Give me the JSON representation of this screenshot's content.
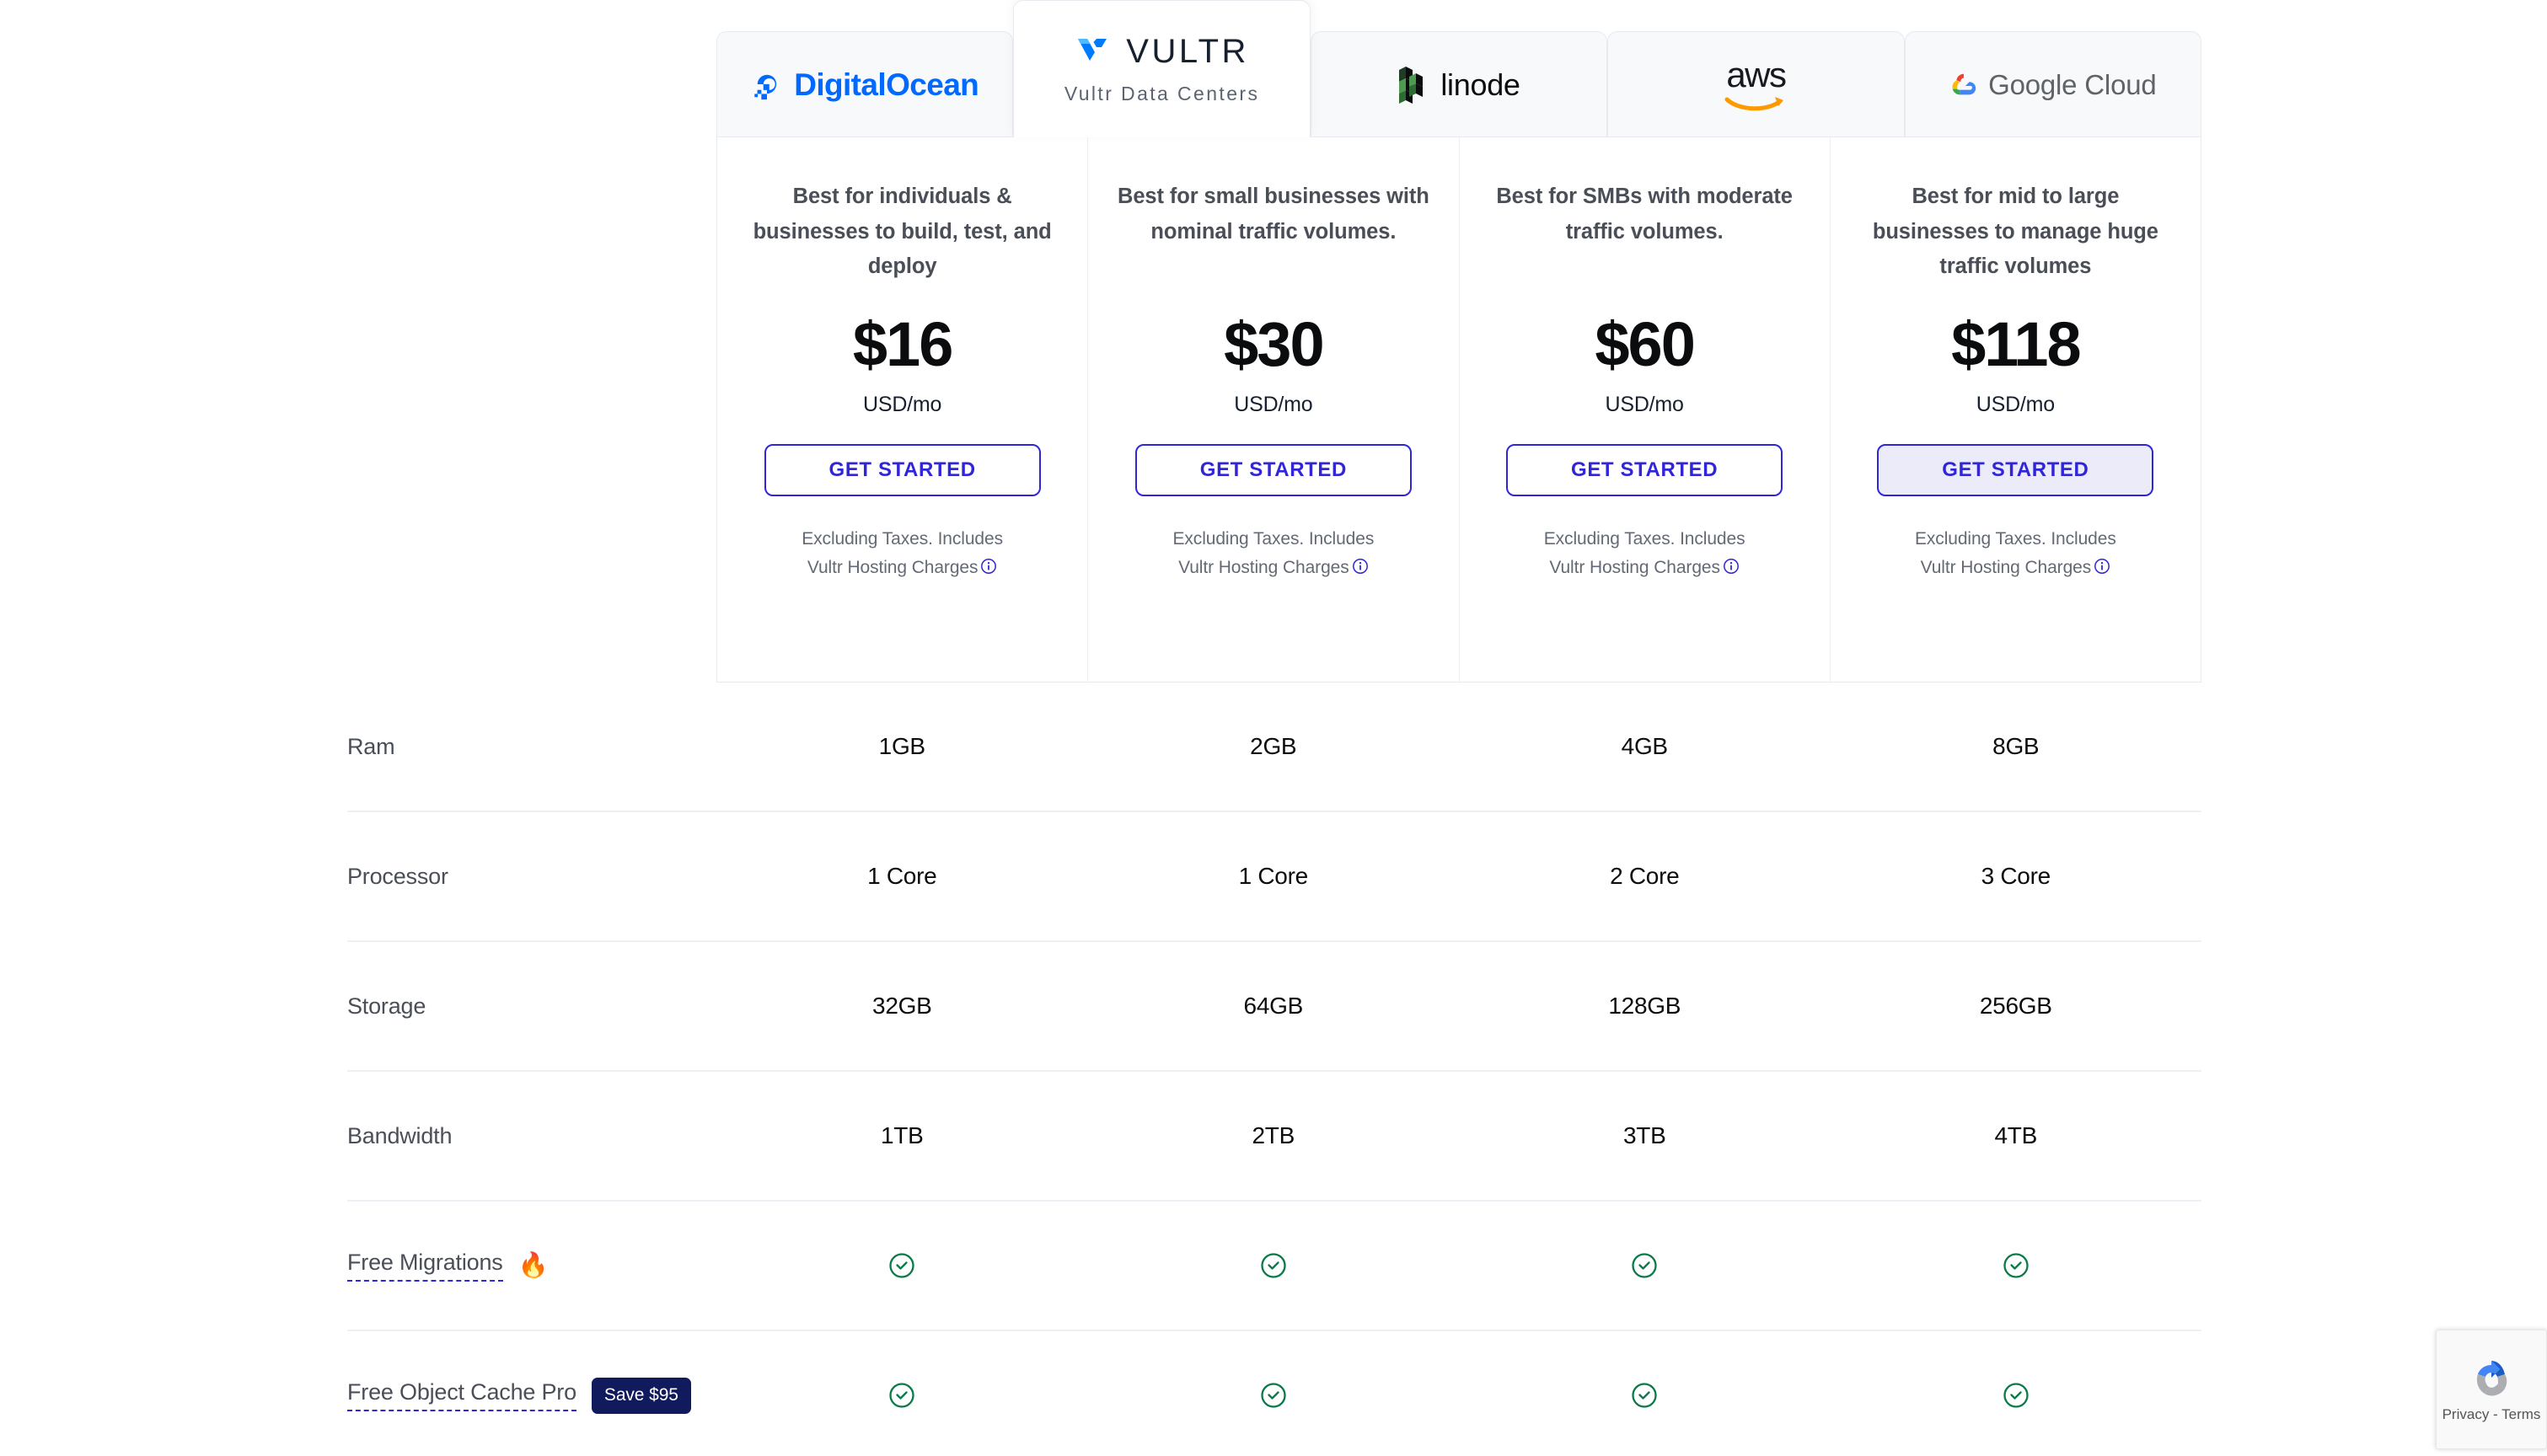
{
  "tabs": [
    {
      "id": "digitalocean",
      "label": "DigitalOcean",
      "active": false
    },
    {
      "id": "vultr",
      "label": "VULTR",
      "sublabel": "Vultr Data Centers",
      "active": true
    },
    {
      "id": "linode",
      "label": "linode",
      "active": false
    },
    {
      "id": "aws",
      "label": "aws",
      "active": false
    },
    {
      "id": "google-cloud",
      "label": "Google Cloud",
      "active": false
    }
  ],
  "plans": [
    {
      "description": "Best for individuals & businesses to build, test, and deploy",
      "price": "$16",
      "period": "USD/mo",
      "cta": "GET STARTED",
      "note_line1": "Excluding Taxes. Includes",
      "note_line2": "Vultr Hosting Charges",
      "highlighted": false
    },
    {
      "description": "Best for small businesses with nominal traffic volumes.",
      "price": "$30",
      "period": "USD/mo",
      "cta": "GET STARTED",
      "note_line1": "Excluding Taxes. Includes",
      "note_line2": "Vultr Hosting Charges",
      "highlighted": false
    },
    {
      "description": "Best for SMBs with moderate traffic volumes.",
      "price": "$60",
      "period": "USD/mo",
      "cta": "GET STARTED",
      "note_line1": "Excluding Taxes. Includes",
      "note_line2": "Vultr Hosting Charges",
      "highlighted": false
    },
    {
      "description": "Best for mid to large businesses to manage huge traffic volumes",
      "price": "$118",
      "period": "USD/mo",
      "cta": "GET STARTED",
      "note_line1": "Excluding Taxes. Includes",
      "note_line2": "Vultr Hosting Charges",
      "highlighted": true
    }
  ],
  "spec_rows": [
    {
      "label": "Ram",
      "values": [
        "1GB",
        "2GB",
        "4GB",
        "8GB"
      ],
      "type": "text"
    },
    {
      "label": "Processor",
      "values": [
        "1 Core",
        "1 Core",
        "2 Core",
        "3 Core"
      ],
      "type": "text"
    },
    {
      "label": "Storage",
      "values": [
        "32GB",
        "64GB",
        "128GB",
        "256GB"
      ],
      "type": "text"
    },
    {
      "label": "Bandwidth",
      "values": [
        "1TB",
        "2TB",
        "3TB",
        "4TB"
      ],
      "type": "text"
    }
  ],
  "feature_rows": [
    {
      "label": "Free Migrations",
      "link": true,
      "emoji": "🔥",
      "badge": null,
      "values": [
        "check",
        "check",
        "check",
        "check"
      ]
    },
    {
      "label": "Free Object Cache Pro",
      "link": true,
      "emoji": null,
      "badge": "Save $95",
      "values": [
        "check",
        "check",
        "check",
        "check"
      ]
    }
  ],
  "recaptcha": {
    "text": "Privacy - Terms"
  },
  "colors": {
    "accent_blue": "#3026d8",
    "check_green": "#0a7a48",
    "badge_navy": "#111a5c",
    "digitalocean_blue": "#0069ff",
    "info_blue": "#3026d8"
  }
}
